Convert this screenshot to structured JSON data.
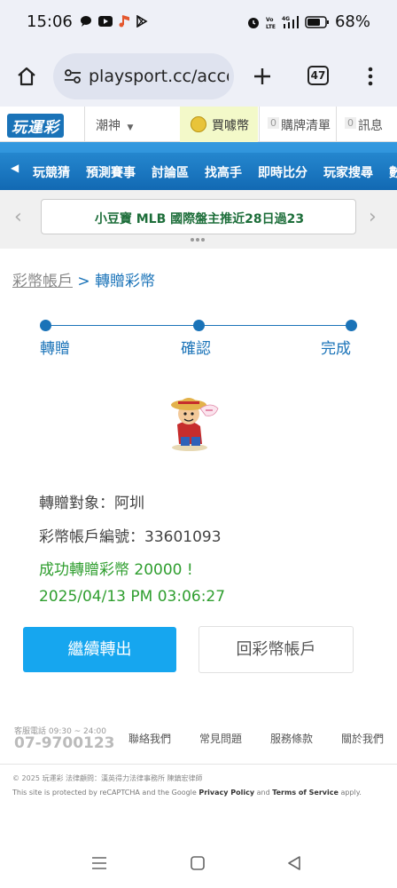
{
  "status_bar": {
    "time": "15:06",
    "battery": "68%",
    "notification_icons": [
      "chat-icon",
      "youtube-icon",
      "music-icon",
      "play-store-icon"
    ],
    "system_icons": [
      "alarm-icon",
      "volte-icon",
      "signal-4g-icon",
      "battery-icon"
    ]
  },
  "browser": {
    "url": "playsport.cc/acco",
    "tab_count": "47"
  },
  "site_header": {
    "logo": "玩運彩",
    "menu_label": "潮神",
    "buy_label": "買噱幣",
    "cart_count": "0",
    "cart_label": "購牌清單",
    "msg_count": "0",
    "msg_label": "訊息"
  },
  "nav": {
    "items": [
      "玩競猜",
      "預測賽事",
      "討論區",
      "找高手",
      "即時比分",
      "玩家搜尋",
      "數據"
    ]
  },
  "banner": {
    "text": "小豆寶 MLB 國際盤主推近28日過23"
  },
  "breadcrumb": {
    "parent": "彩幣帳戶",
    "separator": ">",
    "current": "轉贈彩幣"
  },
  "steps": [
    "轉贈",
    "確認",
    "完成"
  ],
  "result": {
    "recipient": "轉贈對象：阿圳",
    "account": "彩幣帳戶編號：33601093",
    "success": "成功轉贈彩幣 20000 !",
    "timestamp": "2025/04/13 PM 03:06:27"
  },
  "buttons": {
    "continue": "繼續轉出",
    "back": "回彩幣帳戶"
  },
  "footer": {
    "hotline_label": "客服電話 09:30 ~ 24:00",
    "hotline": "07-9700123",
    "links": [
      "聯絡我們",
      "常見問題",
      "服務條款",
      "關於我們"
    ],
    "copyright": "© 2025 玩運彩  法律顧問：漢英得力法律事務所 陳鎮宏律師",
    "recaptcha_pre": "This site is protected by reCAPTCHA and the Google ",
    "privacy": "Privacy Policy",
    "and": " and ",
    "terms": "Terms of Service",
    "apply": " apply."
  },
  "colors": {
    "brand_blue": "#1a73b8",
    "nav_blue": "#1c7cc6",
    "button_blue": "#16a6ef",
    "success_green": "#2f9e2f",
    "banner_green": "#1d6e3a"
  }
}
